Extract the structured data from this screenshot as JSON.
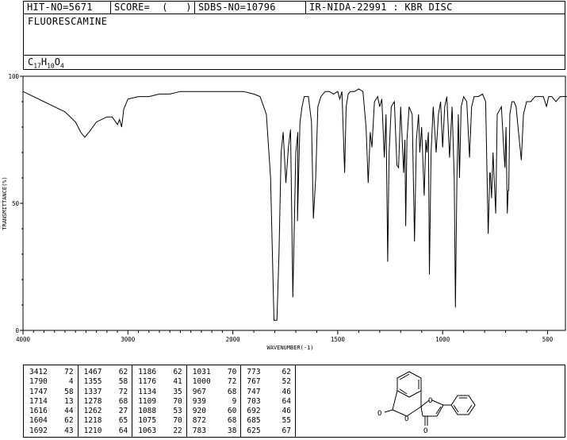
{
  "header": {
    "hit_no": "HIT-NO=5671",
    "score": "SCORE=  (   )",
    "sdbs_no": "SDBS-NO=10796",
    "ir_info": "IR-NIDA-22991 : KBR DISC"
  },
  "compound": {
    "name": "FLUORESCAMINE",
    "formula_parts": [
      "C",
      "17",
      "H",
      "10",
      "O",
      "4"
    ]
  },
  "chart_data": {
    "type": "line",
    "xlabel": "WAVENUMBER(-1)",
    "ylabel": "TRANSMITTANCE(%)",
    "xlim": [
      4000,
      400
    ],
    "ylim": [
      0,
      100
    ],
    "x_ticks": [
      4000,
      3000,
      2000,
      1500,
      1000,
      500
    ],
    "y_ticks": [
      0,
      50,
      100
    ],
    "x_tick_labels": [
      "4000",
      "3000",
      "2000",
      "1500",
      "1000",
      "500"
    ],
    "y_tick_labels": [
      "0",
      "50",
      "100"
    ],
    "series": [
      {
        "points": [
          [
            4000,
            94
          ],
          [
            3900,
            92
          ],
          [
            3800,
            90
          ],
          [
            3700,
            88
          ],
          [
            3600,
            86
          ],
          [
            3500,
            82
          ],
          [
            3450,
            78
          ],
          [
            3412,
            76
          ],
          [
            3370,
            78
          ],
          [
            3300,
            82
          ],
          [
            3250,
            83
          ],
          [
            3200,
            84
          ],
          [
            3150,
            84
          ],
          [
            3100,
            81
          ],
          [
            3080,
            83
          ],
          [
            3060,
            80
          ],
          [
            3040,
            87
          ],
          [
            3000,
            91
          ],
          [
            2900,
            92
          ],
          [
            2800,
            92
          ],
          [
            2700,
            93
          ],
          [
            2600,
            93
          ],
          [
            2500,
            94
          ],
          [
            2400,
            94
          ],
          [
            2300,
            94
          ],
          [
            2200,
            94
          ],
          [
            2100,
            94
          ],
          [
            2000,
            94
          ],
          [
            1950,
            94
          ],
          [
            1900,
            93
          ],
          [
            1870,
            92
          ],
          [
            1840,
            85
          ],
          [
            1820,
            60
          ],
          [
            1804,
            4
          ],
          [
            1790,
            4
          ],
          [
            1780,
            30
          ],
          [
            1770,
            70
          ],
          [
            1760,
            78
          ],
          [
            1747,
            58
          ],
          [
            1735,
            72
          ],
          [
            1725,
            79
          ],
          [
            1714,
            13
          ],
          [
            1700,
            70
          ],
          [
            1690,
            78
          ],
          [
            1692,
            43
          ],
          [
            1680,
            82
          ],
          [
            1670,
            88
          ],
          [
            1660,
            92
          ],
          [
            1640,
            92
          ],
          [
            1625,
            82
          ],
          [
            1616,
            44
          ],
          [
            1605,
            60
          ],
          [
            1595,
            88
          ],
          [
            1580,
            92
          ],
          [
            1560,
            94
          ],
          [
            1540,
            94
          ],
          [
            1520,
            93
          ],
          [
            1500,
            94
          ],
          [
            1490,
            91
          ],
          [
            1480,
            94
          ],
          [
            1467,
            62
          ],
          [
            1460,
            88
          ],
          [
            1450,
            93
          ],
          [
            1440,
            94
          ],
          [
            1420,
            94
          ],
          [
            1400,
            95
          ],
          [
            1380,
            94
          ],
          [
            1365,
            80
          ],
          [
            1355,
            58
          ],
          [
            1345,
            78
          ],
          [
            1337,
            72
          ],
          [
            1325,
            90
          ],
          [
            1310,
            92
          ],
          [
            1300,
            88
          ],
          [
            1290,
            91
          ],
          [
            1278,
            68
          ],
          [
            1270,
            85
          ],
          [
            1262,
            27
          ],
          [
            1255,
            70
          ],
          [
            1245,
            88
          ],
          [
            1230,
            90
          ],
          [
            1218,
            65
          ],
          [
            1210,
            64
          ],
          [
            1200,
            88
          ],
          [
            1186,
            62
          ],
          [
            1180,
            75
          ],
          [
            1176,
            41
          ],
          [
            1170,
            75
          ],
          [
            1160,
            88
          ],
          [
            1145,
            85
          ],
          [
            1134,
            35
          ],
          [
            1125,
            75
          ],
          [
            1115,
            85
          ],
          [
            1109,
            70
          ],
          [
            1100,
            80
          ],
          [
            1088,
            53
          ],
          [
            1080,
            75
          ],
          [
            1075,
            70
          ],
          [
            1068,
            78
          ],
          [
            1063,
            22
          ],
          [
            1055,
            70
          ],
          [
            1045,
            88
          ],
          [
            1031,
            70
          ],
          [
            1020,
            85
          ],
          [
            1010,
            90
          ],
          [
            1000,
            72
          ],
          [
            990,
            88
          ],
          [
            980,
            92
          ],
          [
            967,
            68
          ],
          [
            955,
            88
          ],
          [
            945,
            60
          ],
          [
            939,
            9
          ],
          [
            932,
            60
          ],
          [
            925,
            85
          ],
          [
            920,
            60
          ],
          [
            912,
            88
          ],
          [
            900,
            92
          ],
          [
            885,
            90
          ],
          [
            872,
            68
          ],
          [
            862,
            88
          ],
          [
            850,
            92
          ],
          [
            830,
            92
          ],
          [
            810,
            93
          ],
          [
            795,
            90
          ],
          [
            783,
            38
          ],
          [
            775,
            62
          ],
          [
            773,
            62
          ],
          [
            767,
            52
          ],
          [
            760,
            70
          ],
          [
            747,
            46
          ],
          [
            740,
            85
          ],
          [
            720,
            88
          ],
          [
            708,
            70
          ],
          [
            703,
            64
          ],
          [
            698,
            80
          ],
          [
            692,
            46
          ],
          [
            688,
            55
          ],
          [
            685,
            55
          ],
          [
            680,
            85
          ],
          [
            670,
            90
          ],
          [
            660,
            90
          ],
          [
            650,
            88
          ],
          [
            635,
            75
          ],
          [
            625,
            67
          ],
          [
            615,
            85
          ],
          [
            600,
            90
          ],
          [
            580,
            90
          ],
          [
            560,
            92
          ],
          [
            540,
            92
          ],
          [
            520,
            92
          ],
          [
            505,
            88
          ],
          [
            495,
            92
          ],
          [
            480,
            92
          ],
          [
            460,
            90
          ],
          [
            440,
            92
          ],
          [
            420,
            92
          ],
          [
            400,
            92
          ]
        ]
      }
    ]
  },
  "peak_table": [
    [
      [
        "3412",
        "72"
      ],
      [
        "1790",
        "4"
      ],
      [
        "1747",
        "58"
      ],
      [
        "1714",
        "13"
      ],
      [
        "1616",
        "44"
      ],
      [
        "1604",
        "62"
      ],
      [
        "1692",
        "43"
      ]
    ],
    [
      [
        "1467",
        "62"
      ],
      [
        "1355",
        "58"
      ],
      [
        "1337",
        "72"
      ],
      [
        "1278",
        "68"
      ],
      [
        "1262",
        "27"
      ],
      [
        "1218",
        "65"
      ],
      [
        "1210",
        "64"
      ]
    ],
    [
      [
        "1186",
        "62"
      ],
      [
        "1176",
        "41"
      ],
      [
        "1134",
        "35"
      ],
      [
        "1109",
        "70"
      ],
      [
        "1088",
        "53"
      ],
      [
        "1075",
        "70"
      ],
      [
        "1063",
        "22"
      ]
    ],
    [
      [
        "1031",
        "70"
      ],
      [
        "1000",
        "72"
      ],
      [
        "967",
        "68"
      ],
      [
        "939",
        "9"
      ],
      [
        "920",
        "60"
      ],
      [
        "872",
        "68"
      ],
      [
        "783",
        "38"
      ]
    ],
    [
      [
        "773",
        "62"
      ],
      [
        "767",
        "52"
      ],
      [
        "747",
        "46"
      ],
      [
        "703",
        "64"
      ],
      [
        "692",
        "46"
      ],
      [
        "685",
        "55"
      ],
      [
        "625",
        "67"
      ]
    ]
  ],
  "structure": {
    "atom_labels": [
      "O",
      "O",
      "O",
      "O"
    ]
  }
}
